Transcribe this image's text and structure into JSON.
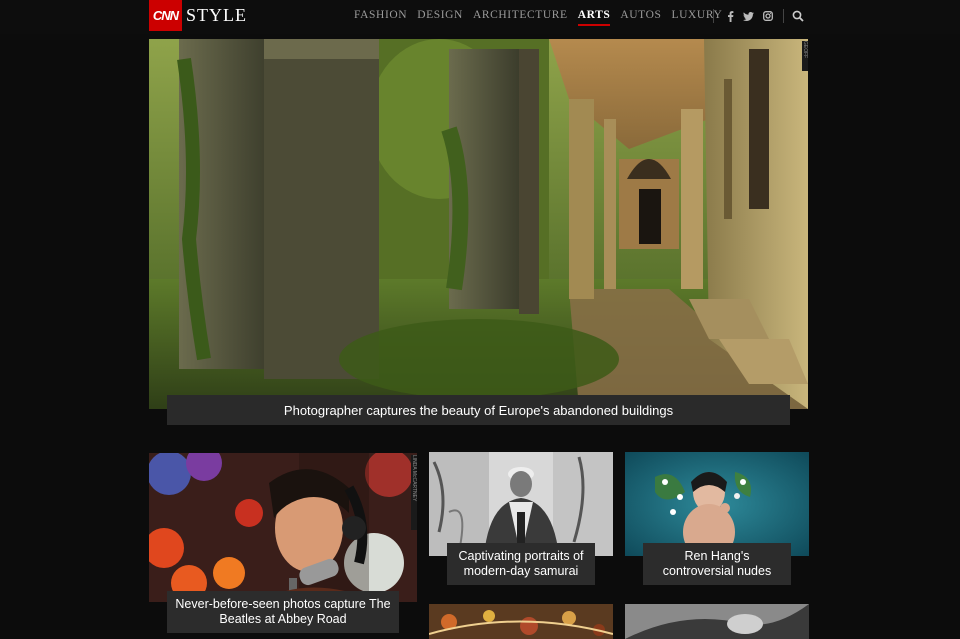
{
  "header": {
    "logo_cnn": "CNN",
    "logo_style": "STYLE",
    "nav": [
      {
        "label": "FASHION",
        "active": false
      },
      {
        "label": "DESIGN",
        "active": false
      },
      {
        "label": "ARCHITECTURE",
        "active": false
      },
      {
        "label": "ARTS",
        "active": true
      },
      {
        "label": "AUTOS",
        "active": false
      },
      {
        "label": "LUXURY",
        "active": false
      }
    ],
    "social": [
      "facebook-icon",
      "twitter-icon",
      "instagram-icon"
    ],
    "search_icon": "search-icon",
    "accent": "#cc0000"
  },
  "hero": {
    "caption": "Photographer captures the beauty of Europe's abandoned buildings"
  },
  "cards": [
    {
      "caption": "Never-before-seen photos capture The Beatles at Abbey Road"
    },
    {
      "caption": "Captivating portraits of modern-day samurai"
    },
    {
      "caption": "Ren Hang's controversial nudes"
    }
  ]
}
